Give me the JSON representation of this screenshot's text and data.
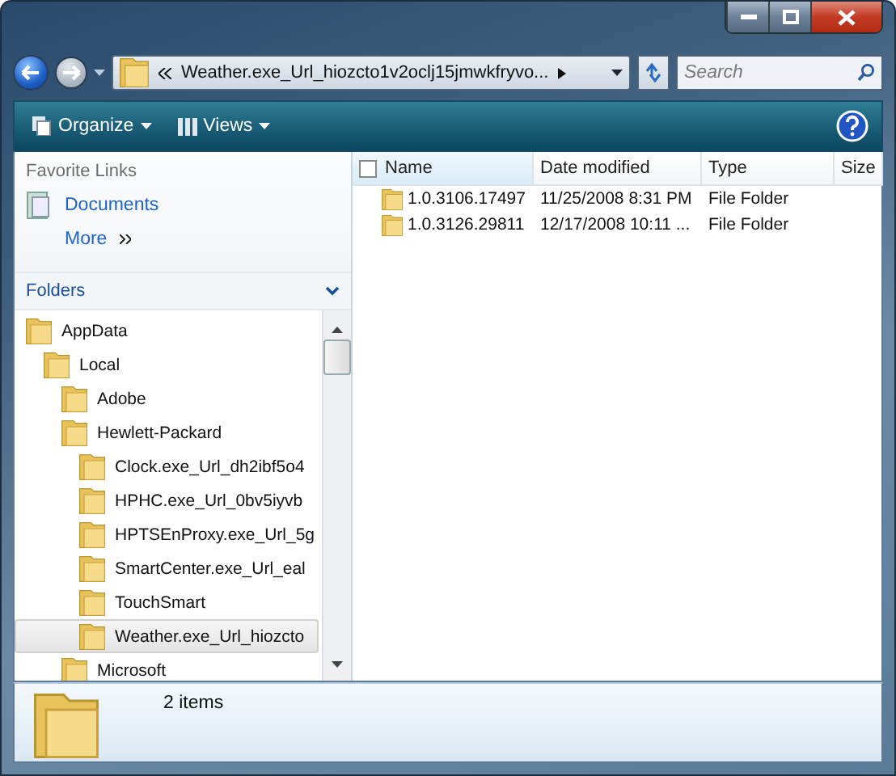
{
  "address_bar": {
    "path": "Weather.exe_Url_hiozcto1v2oclj15jmwkfryvo..."
  },
  "search": {
    "placeholder": "Search"
  },
  "toolbar": {
    "buttons": [
      {
        "label": "Organize"
      },
      {
        "label": "Views"
      }
    ]
  },
  "favorite_links": {
    "title": "Favorite Links",
    "items": [
      {
        "label": "Documents"
      }
    ],
    "more": "More"
  },
  "folders": {
    "title": "Folders",
    "tree": [
      {
        "label": "AppData",
        "selected": false,
        "children": [
          {
            "label": "Local",
            "selected": false,
            "children": [
              {
                "label": "Adobe",
                "selected": false
              },
              {
                "label": "Hewlett-Packard",
                "selected": false,
                "children": [
                  {
                    "label": "Clock.exe_Url_dh2ibf5o4",
                    "selected": false
                  },
                  {
                    "label": "HPHC.exe_Url_0bv5iyvb",
                    "selected": false
                  },
                  {
                    "label": "HPTSEnProxy.exe_Url_5g",
                    "selected": false
                  },
                  {
                    "label": "SmartCenter.exe_Url_eal",
                    "selected": false
                  },
                  {
                    "label": "TouchSmart",
                    "selected": false
                  },
                  {
                    "label": "Weather.exe_Url_hiozcto",
                    "selected": true
                  }
                ]
              },
              {
                "label": "Microsoft",
                "selected": false
              }
            ]
          }
        ]
      }
    ]
  },
  "table": {
    "columns": [
      "Name",
      "Date modified",
      "Type",
      "Size"
    ],
    "rows": [
      {
        "name": "1.0.3106.17497",
        "date_modified": "11/25/2008 8:31 PM",
        "type": "File Folder"
      },
      {
        "name": "1.0.3126.29811",
        "date_modified": "12/17/2008 10:11 ...",
        "type": "File Folder"
      }
    ]
  },
  "status_bar": {
    "text": "2 items"
  }
}
